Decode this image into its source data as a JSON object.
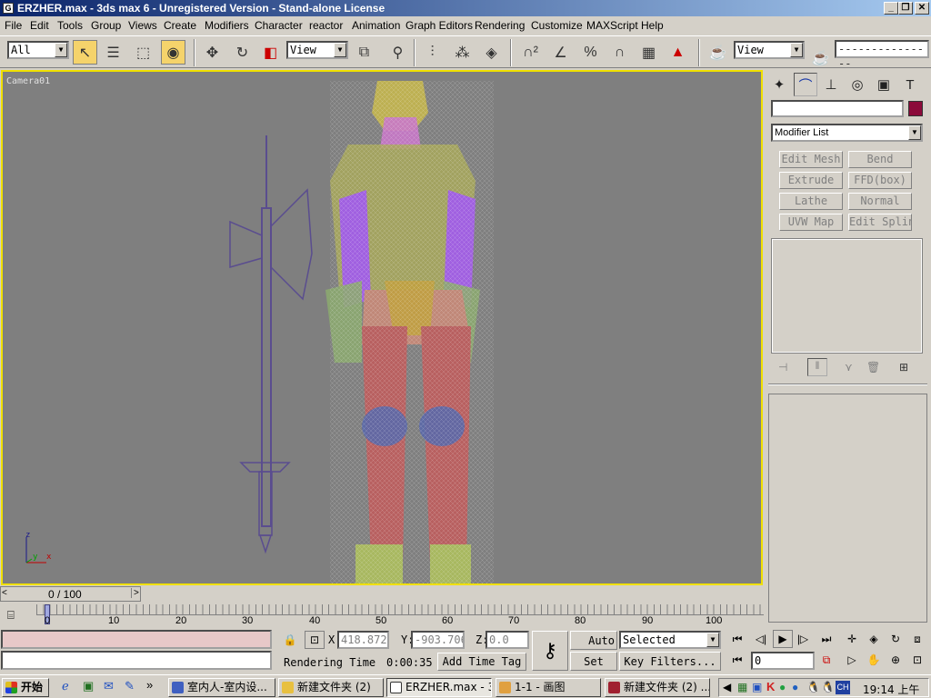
{
  "window": {
    "title": "ERZHER.max - 3ds max 6 - Unregistered Version - Stand-alone License",
    "app_icon": "3ds-max-icon"
  },
  "menu": [
    "File",
    "Edit",
    "Tools",
    "Group",
    "Views",
    "Create",
    "Modifiers",
    "Character",
    "reactor",
    "Animation",
    "Graph Editors",
    "Rendering",
    "Customize",
    "MAXScript",
    "Help"
  ],
  "toolbar": {
    "selection_filter": "All",
    "ref_coord": "View",
    "render_view": "View",
    "named_selection": "---------------"
  },
  "viewport": {
    "label": "Camera01",
    "axis": {
      "z": "z",
      "y": "y",
      "x": "x"
    }
  },
  "command_panel": {
    "color_swatch": "#8b0a3a",
    "modifier_list": "Modifier List",
    "buttons": [
      "Edit Mesh",
      "Bend",
      "Extrude",
      "FFD(box)",
      "Lathe",
      "Normal",
      "UVW Map",
      "Edit Spline"
    ]
  },
  "timeline": {
    "frame": "0 / 100",
    "ticks": [
      "0",
      "10",
      "20",
      "30",
      "40",
      "50",
      "60",
      "70",
      "80",
      "90",
      "100"
    ]
  },
  "status": {
    "x_label": "X:",
    "x_value": "418.872",
    "y_label": "Y:",
    "y_value": "-903.706",
    "z_label": "Z:",
    "z_value": "0.0",
    "rendering_time_label": "Rendering Time",
    "rendering_time": "0:00:35",
    "add_time_tag": "Add Time Tag",
    "auto_key": "Auto Key",
    "set_key": "Set Key",
    "key_mode": "Selected",
    "key_filters": "Key Filters...",
    "current_frame": "0"
  },
  "taskbar": {
    "start": "开始",
    "tasks": [
      "室内人-室内设...",
      "新建文件夹 (2)",
      "ERZHER.max - 3...",
      "1-1 - 画图",
      "新建文件夹 (2) ..."
    ],
    "clock": "19:14 上午",
    "lang": "CH"
  }
}
